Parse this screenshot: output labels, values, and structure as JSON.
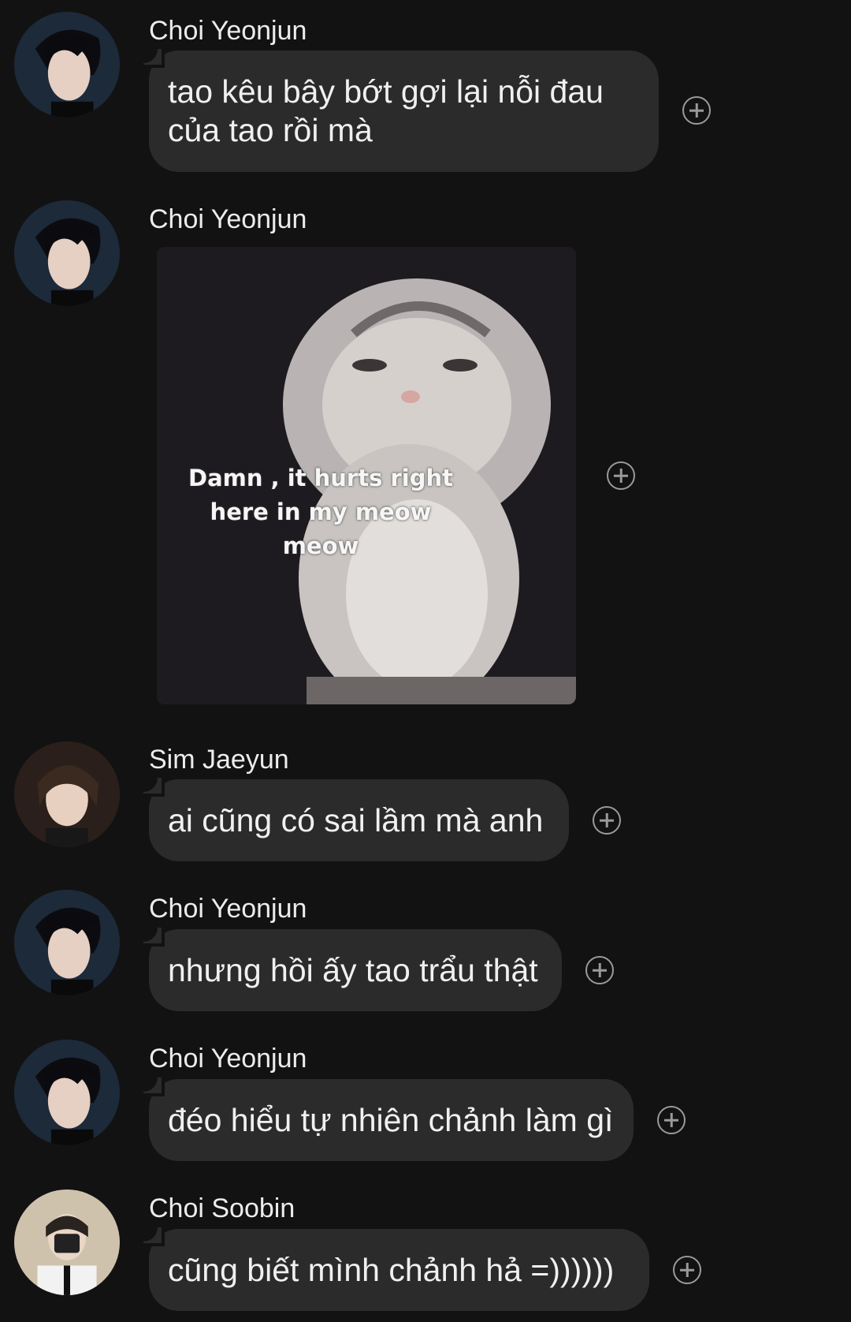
{
  "messages": [
    {
      "sender": "Choi Yeonjun",
      "text": "tao kêu bây bớt gợi lại nỗi đau của tao rồi mà"
    },
    {
      "sender": "Choi Yeonjun",
      "image_caption": "Damn , it hurts right\nhere in my meow\nmeow"
    },
    {
      "sender": "Sim Jaeyun",
      "text": "ai cũng có sai lầm mà anh"
    },
    {
      "sender": "Choi Yeonjun",
      "text": "nhưng hồi ấy tao trẩu thật"
    },
    {
      "sender": "Choi Yeonjun",
      "text": "đéo hiểu tự nhiên chảnh làm gì"
    },
    {
      "sender": "Choi Soobin",
      "text": "cũng biết mình chảnh hả =))))))"
    }
  ],
  "icons": {
    "reaction": "add-reaction-icon",
    "avatar": "avatar"
  },
  "colors": {
    "background": "#121212",
    "bubble": "#2b2b2b",
    "text": "#f0f0f0"
  }
}
